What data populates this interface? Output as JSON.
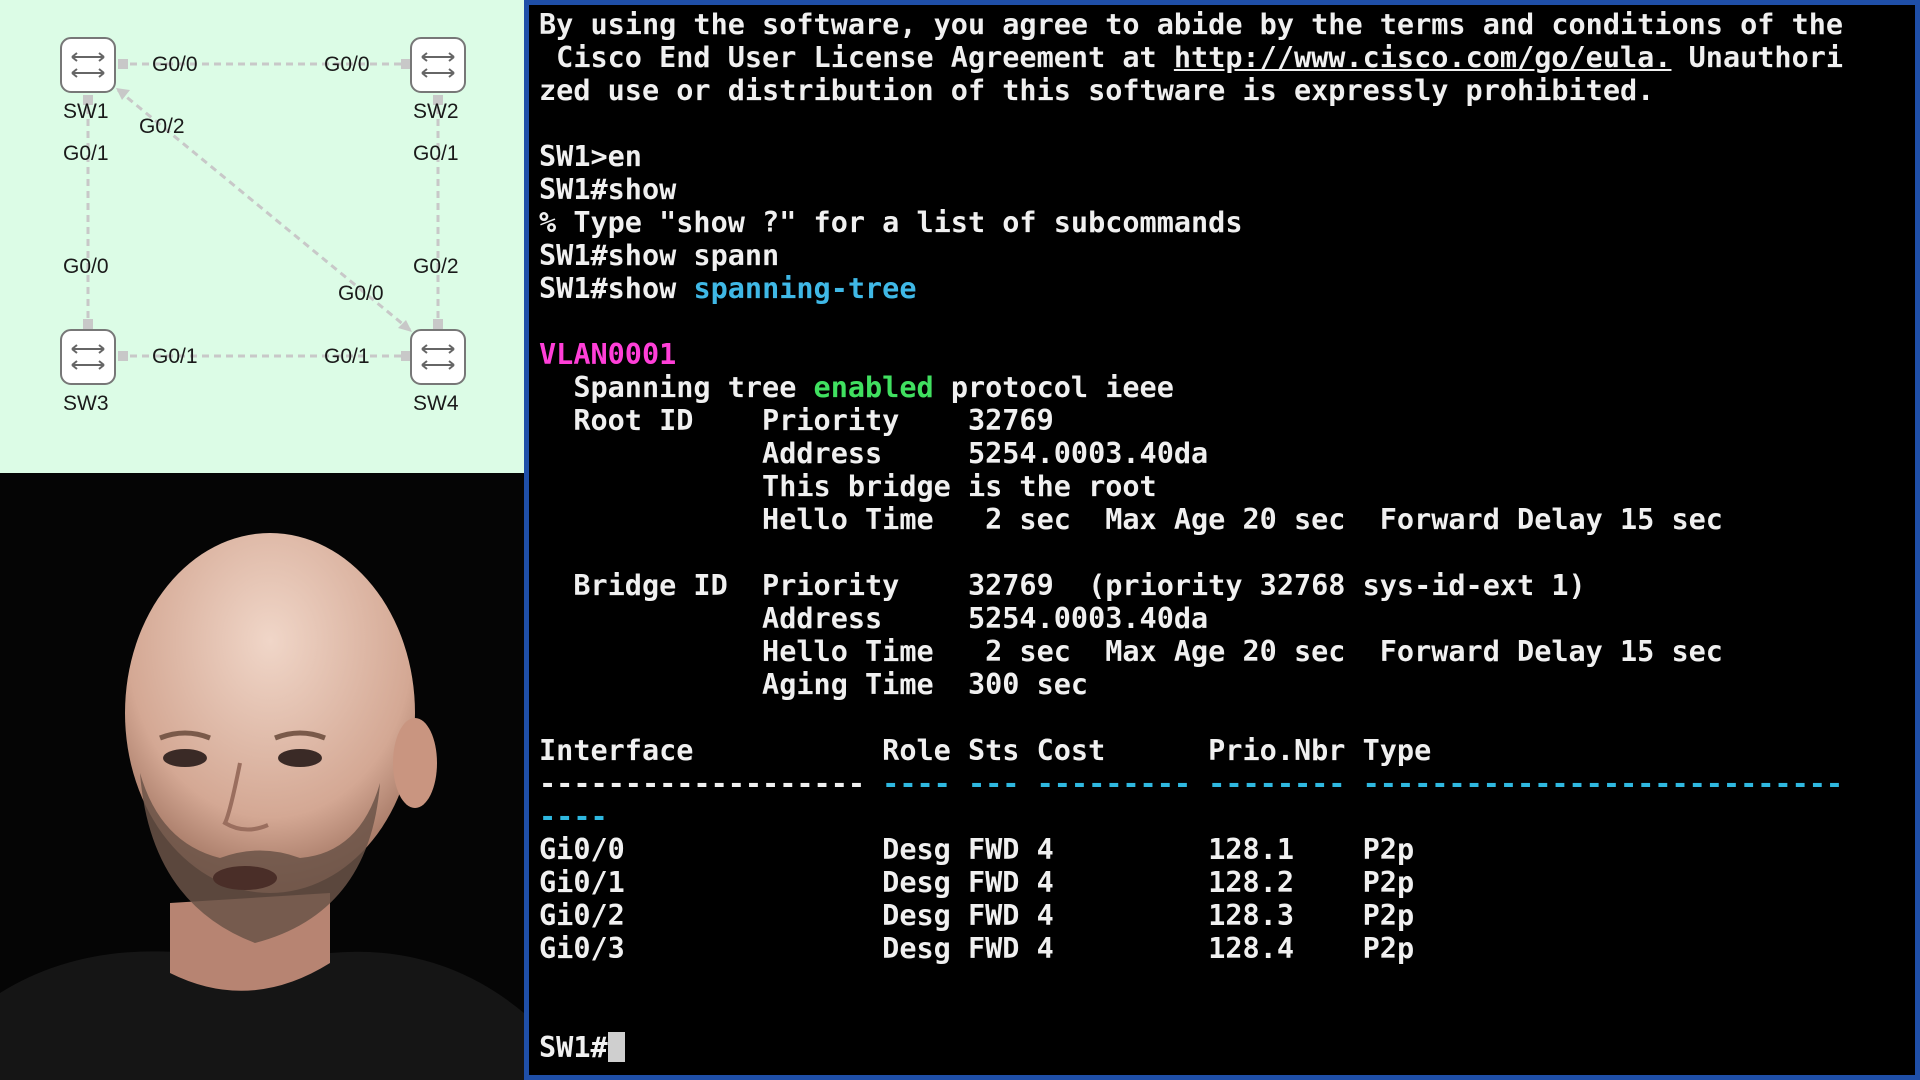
{
  "topology": {
    "switches": {
      "sw1": "SW1",
      "sw2": "SW2",
      "sw3": "SW3",
      "sw4": "SW4"
    },
    "ports": {
      "sw1_g00": "G0/0",
      "sw2_g00": "G0/0",
      "sw1_g02": "G0/2",
      "sw1_g01": "G0/1",
      "sw2_g01": "G0/1",
      "sw3_g00": "G0/0",
      "sw4_g02": "G0/2",
      "sw4_g00": "G0/0",
      "sw3_g01": "G0/1",
      "sw4_g01": "G0/1"
    }
  },
  "terminal": {
    "lines": {
      "l1": "By using the software, you agree to abide by the terms and conditions of the",
      "l2_pre": " Cisco End User License Agreement at ",
      "l2_link": "http://www.cisco.com/go/eula.",
      "l2_post": " Unauthori",
      "l3": "zed use or distribution of this software is expressly prohibited.",
      "l4": "SW1>en",
      "l5": "SW1#show",
      "l6": "% Type \"show ?\" for a list of subcommands",
      "l7": "SW1#show spann",
      "l8_pre": "SW1#show ",
      "l8_cmd": "spanning-tree",
      "l9": "VLAN0001",
      "l10_pre": "  Spanning tree ",
      "l10_kw": "enabled",
      "l10_post": " protocol ieee",
      "l11": "  Root ID    Priority    32769",
      "l12": "             Address     5254.0003.40da",
      "l13": "             This bridge is the root",
      "l14": "             Hello Time   2 sec  Max Age 20 sec  Forward Delay 15 sec",
      "l15": "  Bridge ID  Priority    32769  (priority 32768 sys-id-ext 1)",
      "l16": "             Address     5254.0003.40da",
      "l17": "             Hello Time   2 sec  Max Age 20 sec  Forward Delay 15 sec",
      "l18": "             Aging Time  300 sec",
      "header": "Interface           Role Sts Cost      Prio.Nbr Type",
      "sep1_a": "------------------- ",
      "sep1_b": "---- --- --------- -------- ----------------------------",
      "sep2": "----",
      "prompt": "SW1#"
    },
    "ports": [
      {
        "interface": "Gi0/0",
        "role": "Desg",
        "sts": "FWD",
        "cost": "4",
        "prio_nbr": "128.1",
        "type": "P2p"
      },
      {
        "interface": "Gi0/1",
        "role": "Desg",
        "sts": "FWD",
        "cost": "4",
        "prio_nbr": "128.2",
        "type": "P2p"
      },
      {
        "interface": "Gi0/2",
        "role": "Desg",
        "sts": "FWD",
        "cost": "4",
        "prio_nbr": "128.3",
        "type": "P2p"
      },
      {
        "interface": "Gi0/3",
        "role": "Desg",
        "sts": "FWD",
        "cost": "4",
        "prio_nbr": "128.4",
        "type": "P2p"
      }
    ],
    "colors": {
      "command": "#3fb8e6",
      "enabled": "#40e060",
      "vlan": "#ff3fd8",
      "border": "#1f4fa8"
    }
  },
  "webcam": {
    "icon": "presenter-video"
  }
}
